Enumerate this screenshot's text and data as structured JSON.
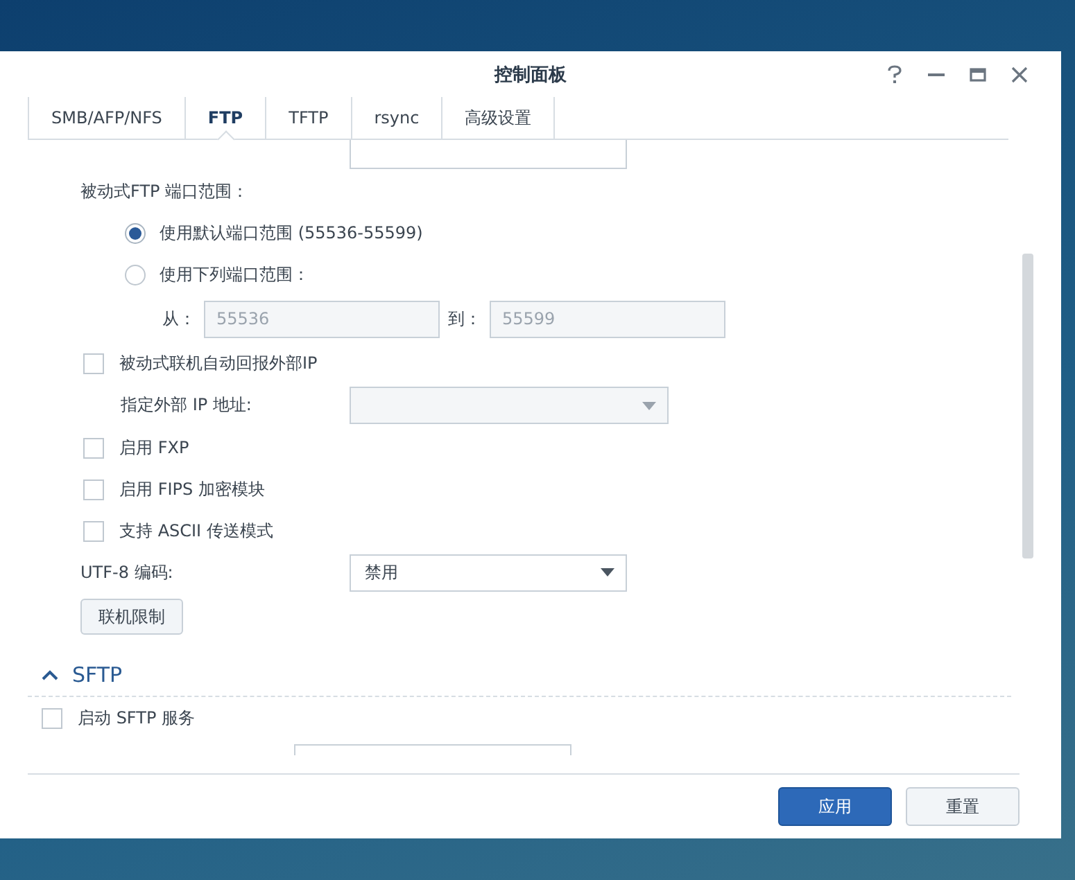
{
  "window": {
    "title": "控制面板"
  },
  "tabs": [
    {
      "label": "SMB/AFP/NFS",
      "selected": false
    },
    {
      "label": "FTP",
      "selected": true
    },
    {
      "label": "TFTP",
      "selected": false
    },
    {
      "label": "rsync",
      "selected": false
    },
    {
      "label": "高级设置",
      "selected": false
    }
  ],
  "passive_range": {
    "label": "被动式FTP 端口范围：",
    "options": [
      {
        "label": "使用默认端口范围 (55536-55599)",
        "selected": true
      },
      {
        "label": "使用下列端口范围：",
        "selected": false
      }
    ],
    "from_label": "从：",
    "from_value": "55536",
    "to_label": "到：",
    "to_value": "55599"
  },
  "report_external_ip": {
    "label": "被动式联机自动回报外部IP",
    "checked": false
  },
  "external_ip": {
    "label": "指定外部 IP 地址:"
  },
  "options": [
    {
      "label": "启用 FXP",
      "checked": false
    },
    {
      "label": "启用 FIPS 加密模块",
      "checked": false
    },
    {
      "label": "支持 ASCII 传送模式",
      "checked": false
    }
  ],
  "utf8": {
    "label": "UTF-8 编码:",
    "value": "禁用"
  },
  "limit_button": "联机限制",
  "sftp": {
    "title": "SFTP",
    "expanded": true,
    "enable": {
      "label": "启动 SFTP 服务",
      "checked": false
    }
  },
  "buttons": {
    "apply": "应用",
    "reset": "重置"
  }
}
